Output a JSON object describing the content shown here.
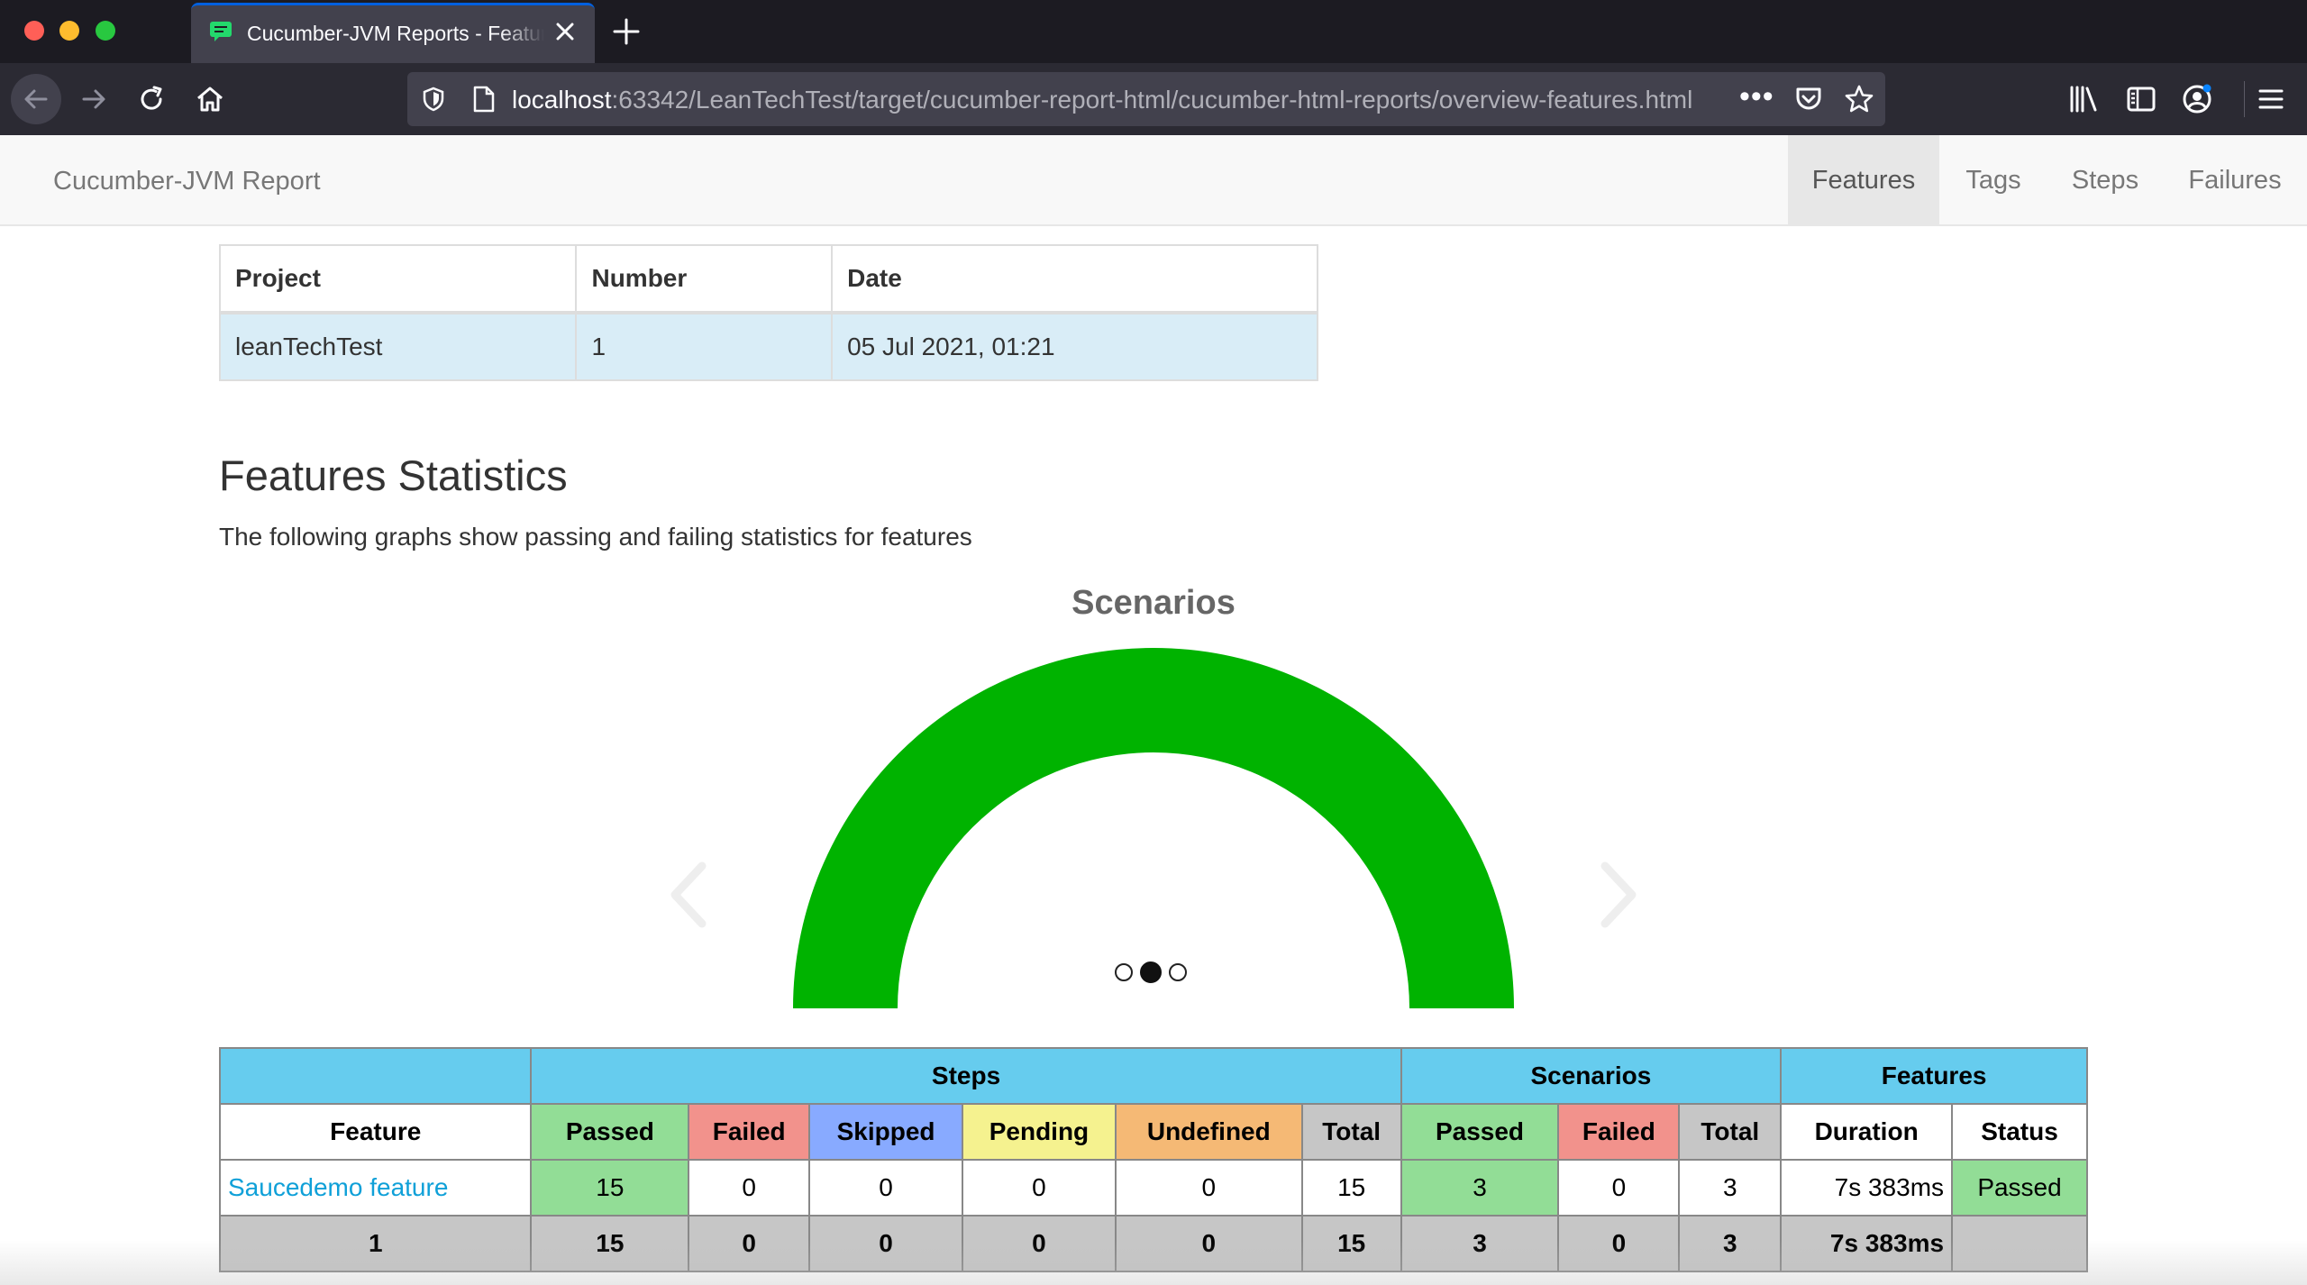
{
  "browser": {
    "tab_title": "Cucumber-JVM Reports - Features Overview",
    "url_host": "localhost",
    "url_path": ":63342/LeanTechTest/target/cucumber-report-html/cucumber-html-reports/overview-features.html",
    "url_menu_label": "•••",
    "icons": [
      "back-icon",
      "forward-icon",
      "reload-icon",
      "home-icon",
      "shield-icon",
      "page-icon",
      "pocket-icon",
      "star-icon",
      "library-icon",
      "sidebar-icon",
      "account-icon",
      "menu-icon"
    ]
  },
  "report_nav": {
    "brand": "Cucumber-JVM Report",
    "items": [
      "Features",
      "Tags",
      "Steps",
      "Failures"
    ],
    "active": "Features"
  },
  "info_table": {
    "headers": [
      "Project",
      "Number",
      "Date"
    ],
    "row": [
      "leanTechTest",
      "1",
      "05 Jul 2021, 01:21"
    ]
  },
  "stats": {
    "title": "Features Statistics",
    "description": "The following graphs show passing and failing statistics for features"
  },
  "chart_data": {
    "type": "pie",
    "title": "Scenarios",
    "categories": [
      "Passed",
      "Failed"
    ],
    "values": [
      3,
      0
    ],
    "colors": [
      "#00b300",
      "#ff0000"
    ],
    "style": "half-donut",
    "carousel_slides": 3,
    "active_slide": 2
  },
  "stats_table": {
    "groups": [
      "",
      "Steps",
      "Scenarios",
      "Features"
    ],
    "headers": [
      "Feature",
      "Passed",
      "Failed",
      "Skipped",
      "Pending",
      "Undefined",
      "Total",
      "Passed",
      "Failed",
      "Total",
      "Duration",
      "Status"
    ],
    "row": {
      "feature": "Saucedemo feature",
      "steps_passed": "15",
      "steps_failed": "0",
      "steps_skipped": "0",
      "steps_pending": "0",
      "steps_undefined": "0",
      "steps_total": "15",
      "scen_passed": "3",
      "scen_failed": "0",
      "scen_total": "3",
      "duration": "7s 383ms",
      "status": "Passed"
    },
    "totals": {
      "feature": "1",
      "steps_passed": "15",
      "steps_failed": "0",
      "steps_skipped": "0",
      "steps_pending": "0",
      "steps_undefined": "0",
      "steps_total": "15",
      "scen_passed": "3",
      "scen_failed": "0",
      "scen_total": "3",
      "duration": "7s 383ms",
      "status": ""
    }
  },
  "colors": {
    "chrome_bg": "#1c1b22",
    "toolbar_bg": "#2b2a33",
    "accent": "#0060df",
    "header_blue": "#66ccee",
    "passed": "#92dd96",
    "failed": "#f2928c",
    "skipped": "#88aaff",
    "pending": "#f5f28f",
    "undefined": "#f5b975",
    "gauge_passed": "#00b300"
  }
}
